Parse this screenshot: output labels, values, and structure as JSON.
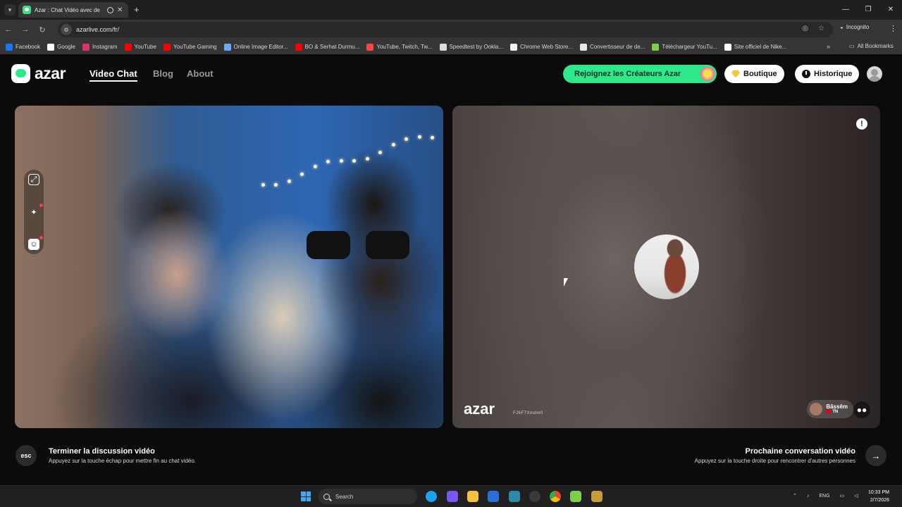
{
  "browser": {
    "tab_title": "Azar : Chat Vidéo avec de",
    "url": "azarlive.com/fr/",
    "incognito_label": "Incognito",
    "bookmarks": [
      {
        "label": "Facebook",
        "color": "#1877f2"
      },
      {
        "label": "Google",
        "color": "#ffffff"
      },
      {
        "label": "Instagram",
        "color": "#e1306c"
      },
      {
        "label": "YouTube",
        "color": "#ff0000"
      },
      {
        "label": "YouTube Gaming",
        "color": "#ff0000"
      },
      {
        "label": "Online Image Editor...",
        "color": "#6aa7ff"
      },
      {
        "label": "BO & Serhat Durmu...",
        "color": "#ff0000"
      },
      {
        "label": "YouTube, Twitch, Tw...",
        "color": "#ff4444"
      },
      {
        "label": "Speedtest by Ookla...",
        "color": "#dddddd"
      },
      {
        "label": "Chrome Web Store...",
        "color": "#f0f0f0"
      },
      {
        "label": "Convertisseur de de...",
        "color": "#e8e8e8"
      },
      {
        "label": "Téléchargeur YouTu...",
        "color": "#7bd14a"
      },
      {
        "label": "Site officiel de Nike...",
        "color": "#ffffff"
      }
    ],
    "all_bookmarks_label": "All Bookmarks"
  },
  "site": {
    "logo_text": "azar",
    "nav": [
      {
        "label": "Video Chat",
        "active": true
      },
      {
        "label": "Blog",
        "active": false
      },
      {
        "label": "About",
        "active": false
      }
    ],
    "creators_button": "Rejoignez les Créateurs Azar",
    "shop_button": "Boutique",
    "history_button": "Historique",
    "accent_color": "#2ee88c"
  },
  "remote_video": {
    "watermark": "azar",
    "watermark_code": "FJ6F7Xmdm0",
    "peer_name": "Bāssêm",
    "peer_country": "TN"
  },
  "footer": {
    "esc_key": "esc",
    "end_title": "Terminer la discussion vidéo",
    "end_subtitle": "Appuyez sur la touche échap pour mettre fin au chat vidéo.",
    "next_title": "Prochaine conversation vidéo",
    "next_subtitle": "Appuyez sur la touche droite pour rencontrer d'autres personnes"
  },
  "taskbar": {
    "search_placeholder": "Search",
    "language": "ENG",
    "time": "10:33 PM",
    "date": "2/7/2026"
  }
}
